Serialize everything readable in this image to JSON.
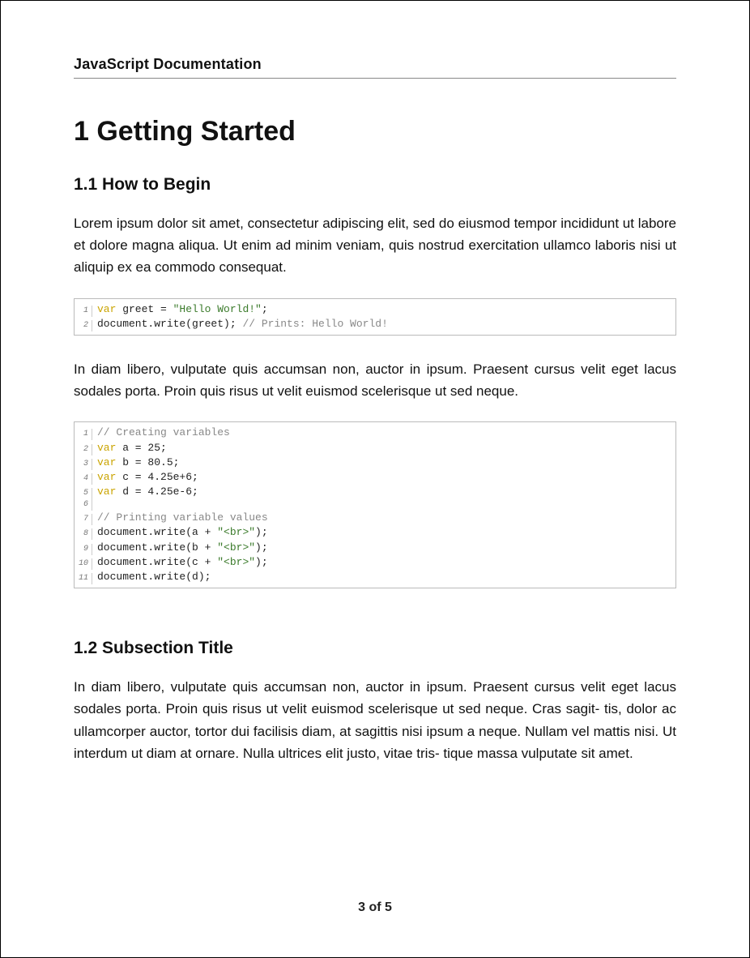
{
  "header": {
    "title": "JavaScript Documentation"
  },
  "section": {
    "number": "1",
    "title": "Getting Started",
    "full_heading": "1 Getting Started",
    "subsections": [
      {
        "number": "1.1",
        "title": "How to Begin",
        "full_heading": "1.1  How to Begin",
        "paragraphs": [
          "Lorem ipsum dolor sit amet, consectetur adipiscing elit, sed do eiusmod tempor incididunt ut labore et dolore magna aliqua.  Ut enim ad minim veniam, quis nostrud exercitation ullamco laboris nisi ut aliquip ex ea commodo consequat.",
          "In diam libero, vulputate quis accumsan non, auctor in ipsum. Praesent cursus velit eget lacus sodales porta.  Proin quis risus ut velit euismod scelerisque ut sed neque."
        ],
        "code_blocks": [
          {
            "lines": [
              {
                "n": 1,
                "tokens": [
                  [
                    "kw",
                    "var"
                  ],
                  [
                    "txt",
                    " greet = "
                  ],
                  [
                    "str",
                    "\"Hello World!\""
                  ],
                  [
                    "txt",
                    ";"
                  ]
                ]
              },
              {
                "n": 2,
                "tokens": [
                  [
                    "txt",
                    "document.write(greet); "
                  ],
                  [
                    "com",
                    "// Prints: Hello World!"
                  ]
                ]
              }
            ]
          },
          {
            "lines": [
              {
                "n": 1,
                "tokens": [
                  [
                    "com",
                    "// Creating variables"
                  ]
                ]
              },
              {
                "n": 2,
                "tokens": [
                  [
                    "kw",
                    "var"
                  ],
                  [
                    "txt",
                    " a = 25;"
                  ]
                ]
              },
              {
                "n": 3,
                "tokens": [
                  [
                    "kw",
                    "var"
                  ],
                  [
                    "txt",
                    " b = 80.5;"
                  ]
                ]
              },
              {
                "n": 4,
                "tokens": [
                  [
                    "kw",
                    "var"
                  ],
                  [
                    "txt",
                    " c = 4.25e+6;"
                  ]
                ]
              },
              {
                "n": 5,
                "tokens": [
                  [
                    "kw",
                    "var"
                  ],
                  [
                    "txt",
                    " d = 4.25e-6;"
                  ]
                ]
              },
              {
                "n": 6,
                "tokens": [
                  [
                    "txt",
                    ""
                  ]
                ]
              },
              {
                "n": 7,
                "tokens": [
                  [
                    "com",
                    "// Printing variable values"
                  ]
                ]
              },
              {
                "n": 8,
                "tokens": [
                  [
                    "txt",
                    "document.write(a + "
                  ],
                  [
                    "str",
                    "\"<br>\""
                  ],
                  [
                    "txt",
                    ");"
                  ]
                ]
              },
              {
                "n": 9,
                "tokens": [
                  [
                    "txt",
                    "document.write(b + "
                  ],
                  [
                    "str",
                    "\"<br>\""
                  ],
                  [
                    "txt",
                    ");"
                  ]
                ]
              },
              {
                "n": 10,
                "tokens": [
                  [
                    "txt",
                    "document.write(c + "
                  ],
                  [
                    "str",
                    "\"<br>\""
                  ],
                  [
                    "txt",
                    ");"
                  ]
                ]
              },
              {
                "n": 11,
                "tokens": [
                  [
                    "txt",
                    "document.write(d);"
                  ]
                ]
              }
            ]
          }
        ]
      },
      {
        "number": "1.2",
        "title": "Subsection Title",
        "full_heading": "1.2  Subsection Title",
        "paragraphs": [
          "In diam libero, vulputate quis accumsan non, auctor in ipsum. Praesent cursus velit eget lacus sodales porta.  Proin quis risus ut velit euismod scelerisque ut sed neque.  Cras sagit- tis, dolor ac ullamcorper auctor, tortor dui facilisis diam, at sagittis nisi ipsum a neque.  Nullam vel mattis nisi. Ut interdum ut diam at ornare.  Nulla ultrices elit justo, vitae tris- tique massa vulputate sit amet."
        ],
        "code_blocks": []
      }
    ]
  },
  "footer": {
    "page_current": 3,
    "page_total": 5,
    "label": "3 of 5"
  }
}
